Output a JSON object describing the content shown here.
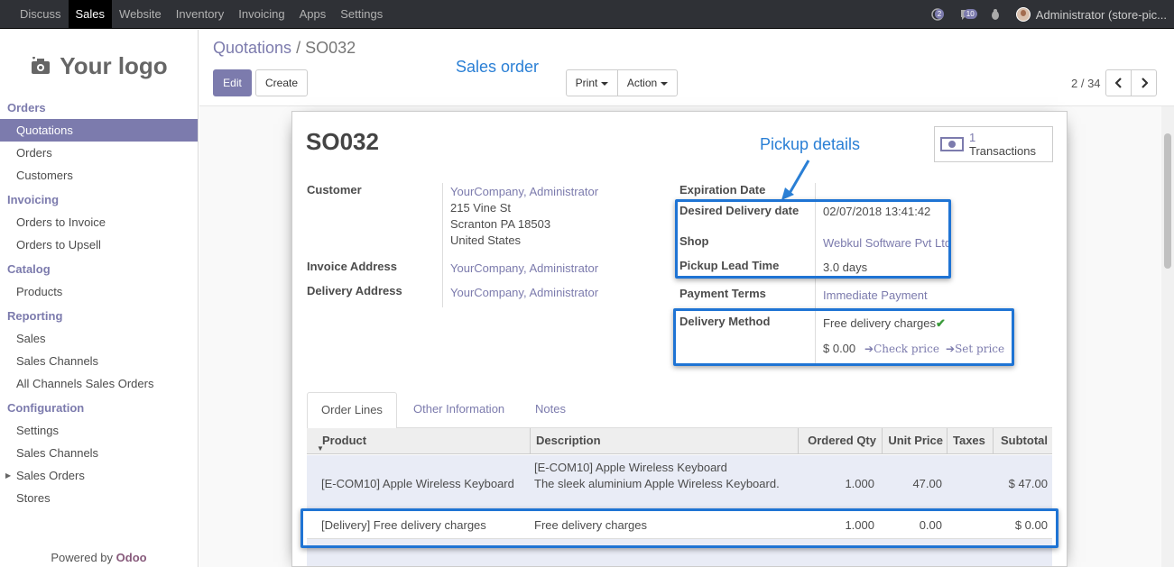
{
  "topbar": {
    "menu": [
      "Discuss",
      "Sales",
      "Website",
      "Inventory",
      "Invoicing",
      "Apps",
      "Settings"
    ],
    "active": "Sales",
    "chat_count": "2",
    "messages_count": "10",
    "user": "Administrator (store-pic..."
  },
  "sidebar": {
    "logo_text": "Your logo",
    "sections": [
      {
        "title": "Orders",
        "items": [
          "Quotations",
          "Orders",
          "Customers"
        ]
      },
      {
        "title": "Invoicing",
        "items": [
          "Orders to Invoice",
          "Orders to Upsell"
        ]
      },
      {
        "title": "Catalog",
        "items": [
          "Products"
        ]
      },
      {
        "title": "Reporting",
        "items": [
          "Sales",
          "Sales Channels",
          "All Channels Sales Orders"
        ]
      },
      {
        "title": "Configuration",
        "items": [
          "Settings",
          "Sales Channels",
          "Sales Orders",
          "Stores"
        ]
      }
    ],
    "powered_prefix": "Powered by ",
    "powered_brand": "Odoo"
  },
  "control": {
    "breadcrumb_parent": "Quotations",
    "breadcrumb_sep": "/",
    "breadcrumb_current": "SO032",
    "edit": "Edit",
    "create": "Create",
    "print": "Print",
    "action": "Action",
    "pager": "2 / 34"
  },
  "annotations": {
    "sales_order": "Sales order",
    "pickup_details": "Pickup details"
  },
  "form": {
    "title": "SO032",
    "transactions_count": "1",
    "transactions_label": "Transactions",
    "customer_label": "Customer",
    "customer_name": "YourCompany, Administrator",
    "customer_street": "215 Vine St",
    "customer_city": "Scranton PA 18503",
    "customer_country": "United States",
    "invoice_label": "Invoice Address",
    "invoice_value": "YourCompany, Administrator",
    "delivery_label": "Delivery Address",
    "delivery_value": "YourCompany, Administrator",
    "expiration_label": "Expiration Date",
    "desired_label": "Desired Delivery date",
    "desired_value": "02/07/2018 13:41:42",
    "shop_label": "Shop",
    "shop_value": "Webkul Software Pvt Ltd",
    "lead_label": "Pickup Lead Time",
    "lead_value": "3.0 days",
    "payment_label": "Payment Terms",
    "payment_value": "Immediate Payment",
    "method_label": "Delivery Method",
    "method_value": "Free delivery charges",
    "method_price": "$ 0.00",
    "check_price": "Check price",
    "set_price": "Set price"
  },
  "tabs": [
    "Order Lines",
    "Other Information",
    "Notes"
  ],
  "table": {
    "headers": [
      "Product",
      "Description",
      "Ordered Qty",
      "Unit Price",
      "Taxes",
      "Subtotal"
    ],
    "rows": [
      {
        "product": "[E-COM10] Apple Wireless Keyboard",
        "desc1": "[E-COM10] Apple Wireless Keyboard",
        "desc2": "The sleek aluminium Apple Wireless Keyboard.",
        "qty": "1.000",
        "price": "47.00",
        "taxes": "",
        "subtotal": "$ 47.00"
      },
      {
        "product": "[Delivery] Free delivery charges",
        "desc1": "Free delivery charges",
        "desc2": "",
        "qty": "1.000",
        "price": "0.00",
        "taxes": "",
        "subtotal": "$ 0.00"
      }
    ]
  },
  "colors": {
    "accent": "#7c7bad",
    "highlight": "#1f74d4",
    "annotation": "#2a7fd5"
  }
}
